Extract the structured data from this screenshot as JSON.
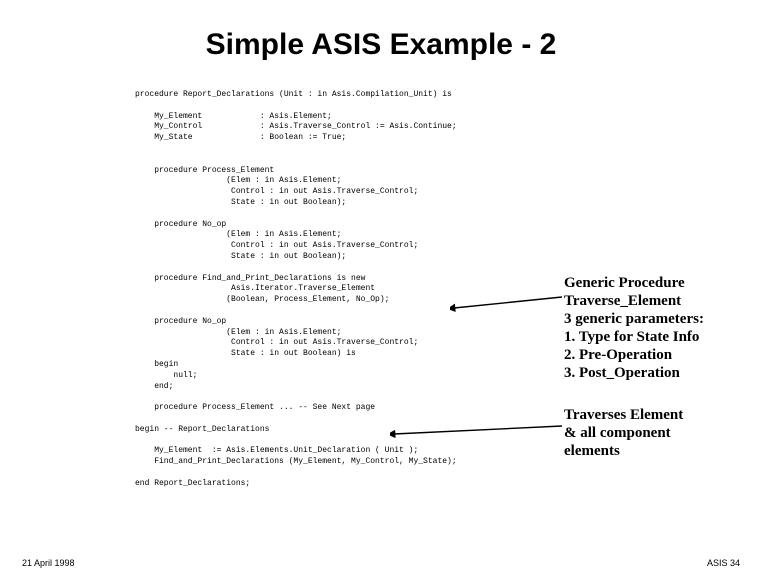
{
  "title": "Simple ASIS Example - 2",
  "code": "procedure Report_Declarations (Unit : in Asis.Compilation_Unit) is\n\n    My_Element            : Asis.Element;\n    My_Control            : Asis.Traverse_Control := Asis.Continue;\n    My_State              : Boolean := True;\n\n\n    procedure Process_Element\n                   (Elem : in Asis.Element;\n                    Control : in out Asis.Traverse_Control;\n                    State : in out Boolean);\n\n    procedure No_op\n                   (Elem : in Asis.Element;\n                    Control : in out Asis.Traverse_Control;\n                    State : in out Boolean);\n\n    procedure Find_and_Print_Declarations is new\n                    Asis.Iterator.Traverse_Element\n                   (Boolean, Process_Element, No_Op);\n\n    procedure No_op\n                   (Elem : in Asis.Element;\n                    Control : in out Asis.Traverse_Control;\n                    State : in out Boolean) is\n    begin\n        null;\n    end;\n\n    procedure Process_Element ... -- See Next page\n\nbegin -- Report_Declarations\n\n    My_Element  := Asis.Elements.Unit_Declaration ( Unit );\n    Find_and_Print_Declarations (My_Element, My_Control, My_State);\n\nend Report_Declarations;",
  "annotation1": {
    "line1": "Generic Procedure",
    "line2": "Traverse_Element",
    "line3": "3 generic parameters:",
    "line4": "1.  Type for State Info",
    "line5": "2.  Pre-Operation",
    "line6": "3.  Post_Operation"
  },
  "annotation2": {
    "line1": "Traverses Element",
    "line2": "& all component",
    "line3": "elements"
  },
  "footer": {
    "left": "21 April 1998",
    "right": "ASIS 34"
  }
}
